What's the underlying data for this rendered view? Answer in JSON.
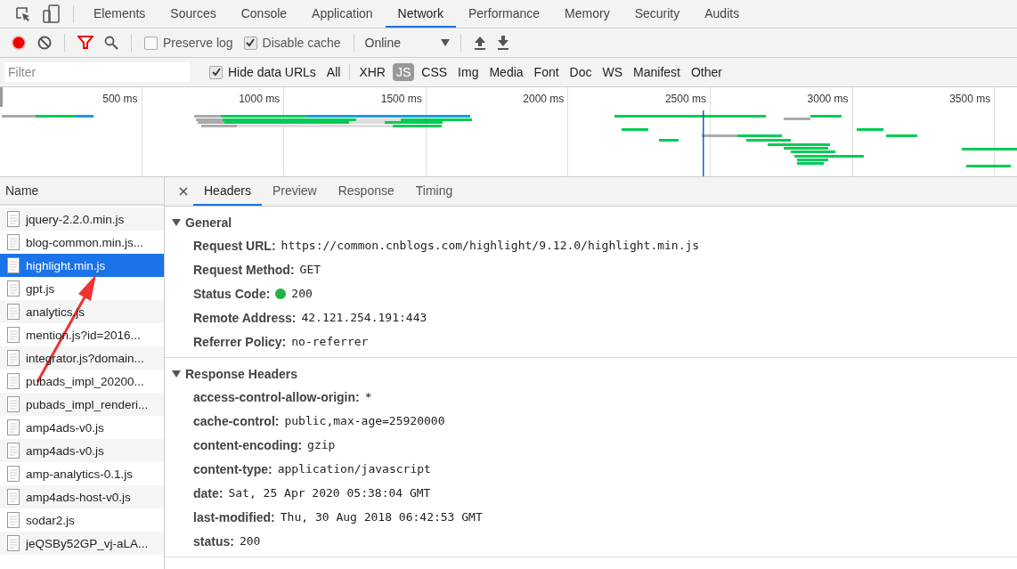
{
  "main_tabs": [
    {
      "label": "Elements",
      "selected": false
    },
    {
      "label": "Sources",
      "selected": false
    },
    {
      "label": "Console",
      "selected": false
    },
    {
      "label": "Application",
      "selected": false
    },
    {
      "label": "Network",
      "selected": true
    },
    {
      "label": "Performance",
      "selected": false
    },
    {
      "label": "Memory",
      "selected": false
    },
    {
      "label": "Security",
      "selected": false
    },
    {
      "label": "Audits",
      "selected": false
    }
  ],
  "toolbar": {
    "recording": true,
    "filter_active": true,
    "preserve_log": {
      "label": "Preserve log",
      "checked": false
    },
    "disable_cache": {
      "label": "Disable cache",
      "checked": true
    },
    "throttling": "Online"
  },
  "filter_bar": {
    "placeholder": "Filter",
    "hide_data_urls": {
      "label": "Hide data URLs",
      "checked": true
    },
    "types": [
      {
        "label": "All",
        "selected": false
      },
      {
        "label": "XHR",
        "selected": false
      },
      {
        "label": "JS",
        "selected": true
      },
      {
        "label": "CSS",
        "selected": false
      },
      {
        "label": "Img",
        "selected": false
      },
      {
        "label": "Media",
        "selected": false
      },
      {
        "label": "Font",
        "selected": false
      },
      {
        "label": "Doc",
        "selected": false
      },
      {
        "label": "WS",
        "selected": false
      },
      {
        "label": "Manifest",
        "selected": false
      },
      {
        "label": "Other",
        "selected": false
      }
    ]
  },
  "overview": {
    "ticks": [
      "500 ms",
      "1000 ms",
      "1500 ms",
      "2000 ms",
      "2500 ms",
      "3000 ms",
      "3500 ms"
    ]
  },
  "requests": {
    "column": "Name",
    "rows": [
      {
        "name": "jquery-2.2.0.min.js",
        "selected": false
      },
      {
        "name": "blog-common.min.js...",
        "selected": false
      },
      {
        "name": "highlight.min.js",
        "selected": true
      },
      {
        "name": "gpt.js",
        "selected": false
      },
      {
        "name": "analytics.js",
        "selected": false
      },
      {
        "name": "mention.js?id=2016...",
        "selected": false
      },
      {
        "name": "integrator.js?domain...",
        "selected": false
      },
      {
        "name": "pubads_impl_20200...",
        "selected": false
      },
      {
        "name": "pubads_impl_renderi...",
        "selected": false
      },
      {
        "name": "amp4ads-v0.js",
        "selected": false
      },
      {
        "name": "amp4ads-v0.js",
        "selected": false
      },
      {
        "name": "amp-analytics-0.1.js",
        "selected": false
      },
      {
        "name": "amp4ads-host-v0.js",
        "selected": false
      },
      {
        "name": "sodar2.js",
        "selected": false
      },
      {
        "name": "jeQSBy52GP_vj-aLA...",
        "selected": false
      }
    ]
  },
  "detail_tabs": [
    {
      "label": "Headers",
      "selected": true
    },
    {
      "label": "Preview",
      "selected": false
    },
    {
      "label": "Response",
      "selected": false
    },
    {
      "label": "Timing",
      "selected": false
    }
  ],
  "sections": [
    {
      "title": "General",
      "expanded": true,
      "fields": [
        {
          "key": "Request URL:",
          "value": "https://common.cnblogs.com/highlight/9.12.0/highlight.min.js"
        },
        {
          "key": "Request Method:",
          "value": "GET"
        },
        {
          "key": "Status Code:",
          "value": "200",
          "color": "#22b14c"
        },
        {
          "key": "Remote Address:",
          "value": "42.121.254.191:443"
        },
        {
          "key": "Referrer Policy:",
          "value": "no-referrer"
        }
      ]
    },
    {
      "title": "Response Headers",
      "expanded": true,
      "fields": [
        {
          "key": "access-control-allow-origin:",
          "value": "*"
        },
        {
          "key": "cache-control:",
          "value": "public,max-age=25920000"
        },
        {
          "key": "content-encoding:",
          "value": "gzip"
        },
        {
          "key": "content-type:",
          "value": "application/javascript"
        },
        {
          "key": "date:",
          "value": "Sat, 25 Apr 2020 05:38:04 GMT"
        },
        {
          "key": "last-modified:",
          "value": "Thu, 30 Aug 2018 06:42:53 GMT"
        },
        {
          "key": "status:",
          "value": "200"
        }
      ]
    }
  ]
}
